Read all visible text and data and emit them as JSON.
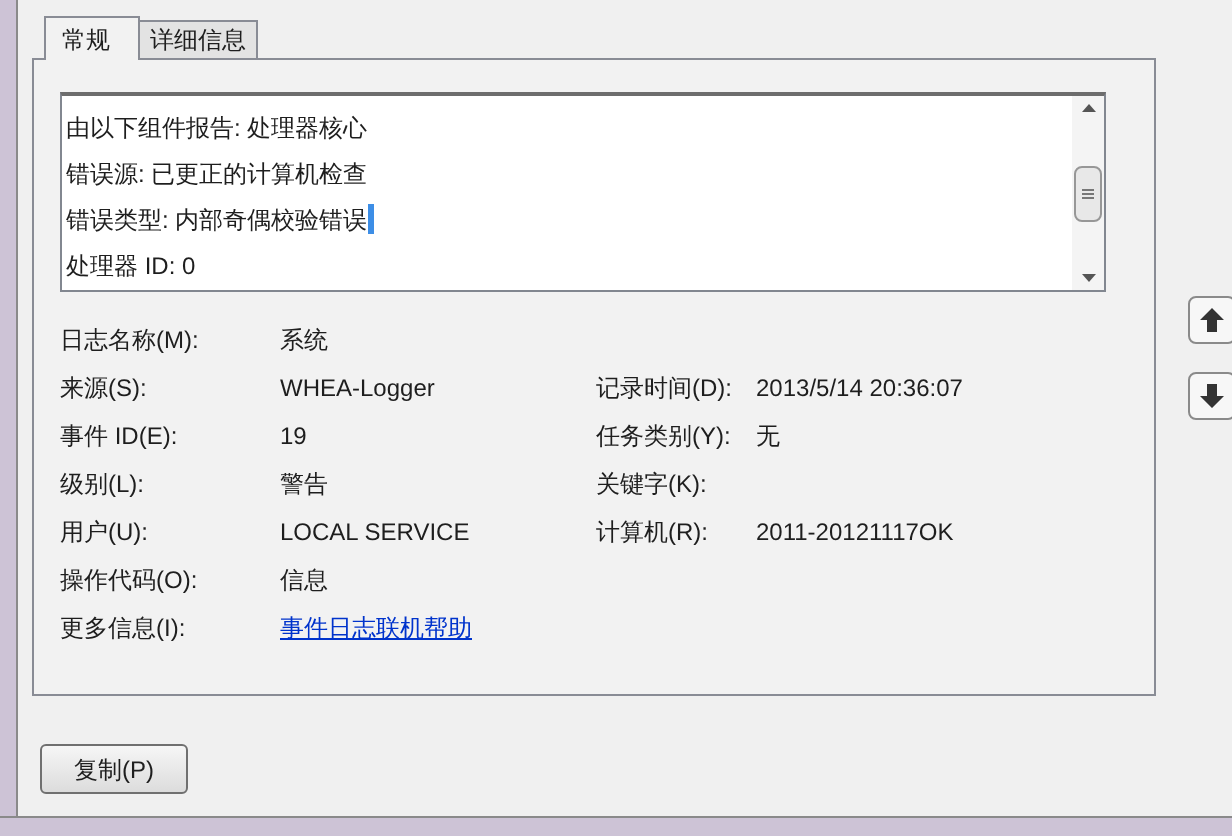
{
  "tabs": [
    {
      "label": "常规",
      "selected": true
    },
    {
      "label": "详细信息",
      "selected": false
    }
  ],
  "description": {
    "lines": [
      {
        "text": "由以下组件报告: 处理器核心",
        "cursor": false
      },
      {
        "text": "错误源: 已更正的计算机检查",
        "cursor": false
      },
      {
        "text": "错误类型: 内部奇偶校验错误",
        "cursor": true
      },
      {
        "text": "处理器 ID: 0",
        "cursor": false
      }
    ]
  },
  "properties": [
    {
      "label": "日志名称(M):",
      "value": "系统"
    },
    {
      "label": "来源(S):",
      "value": "WHEA-Logger",
      "right_label": "记录时间(D):",
      "right_value": "2013/5/14 20:36:07"
    },
    {
      "label": "事件 ID(E):",
      "value": "19",
      "right_label": "任务类别(Y):",
      "right_value": "无"
    },
    {
      "label": "级别(L):",
      "value": "警告",
      "right_label": "关键字(K):"
    },
    {
      "label": "用户(U):",
      "value": "LOCAL SERVICE",
      "right_label": "计算机(R):",
      "right_value": "2011-20121117OK"
    },
    {
      "label": "操作代码(O):",
      "value": "信息"
    },
    {
      "label": "更多信息(I):",
      "value": "事件日志联机帮助",
      "kind": "link"
    }
  ],
  "copy_button": "复制(P)"
}
